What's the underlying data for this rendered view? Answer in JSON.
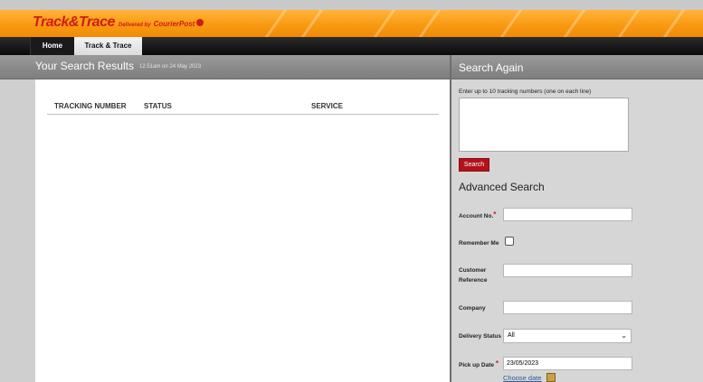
{
  "brand": {
    "logo_text": "Track&Trace",
    "delivered_by": "Delivered by",
    "courier_brand": "CourierPost"
  },
  "nav": {
    "home": "Home",
    "track_trace": "Track & Trace"
  },
  "results": {
    "title": "Your Search Results",
    "timestamp": "12.51am on 24 May 2023",
    "columns": [
      "TRACKING NUMBER",
      "STATUS",
      "SERVICE"
    ]
  },
  "search_again": {
    "title": "Search Again",
    "hint": "Enter up to 10 tracking numbers (one on each line)",
    "button": "Search"
  },
  "advanced": {
    "title": "Advanced Search",
    "account_label": "Account No.",
    "remember_label": "Remember Me",
    "customer_ref_label_1": "Customer",
    "customer_ref_label_2": "Reference",
    "company_label": "Company",
    "delivery_status_label": "Delivery Status",
    "delivery_status_value": "All",
    "pickup_date_label": "Pick up Date",
    "pickup_date_value": "23/05/2023",
    "choose_date": "Choose date",
    "required_mark": "*"
  },
  "colors": {
    "brand_red": "#d01c16",
    "banner_orange": "#f89a12",
    "button_red": "#b3121a"
  }
}
